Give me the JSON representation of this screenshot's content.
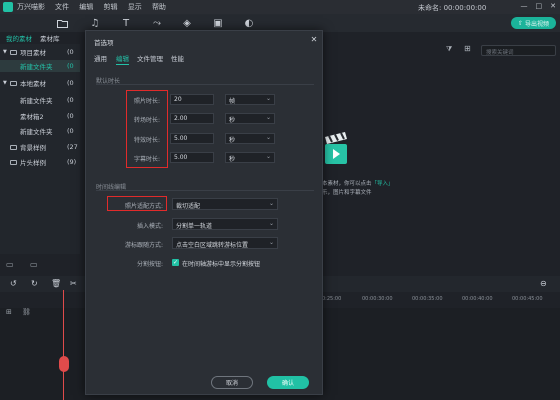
{
  "titlebar": {
    "app_name": "万兴喵影",
    "menu": [
      "文件",
      "编辑",
      "剪辑",
      "显示",
      "帮助"
    ],
    "project": "未命名: 00:00:00:00"
  },
  "toolbar": {
    "icons": [
      "folder-icon",
      "music-icon",
      "text-icon",
      "transition-icon",
      "effects-icon",
      "elements-icon",
      "split-screen-icon"
    ],
    "export_label": "导出视频"
  },
  "left_tabs": {
    "my_media": "我的素材",
    "library": "素材库"
  },
  "left_tree": [
    {
      "label": "项目素材",
      "count": "(0"
    },
    {
      "label": "新建文件夹",
      "count": "(0"
    },
    {
      "label": "本地素材",
      "count": "(0"
    },
    {
      "label": "新建文件夹",
      "count": "(0"
    },
    {
      "label": "素材箱2",
      "count": "(0"
    },
    {
      "label": "新建文件夹",
      "count": "(0"
    },
    {
      "label": "背景样例",
      "count": "(27"
    },
    {
      "label": "片头样例",
      "count": "(9)"
    }
  ],
  "media_panel": {
    "search_placeholder": "搜索关键词",
    "hint_line1_prefix": "本素材，你可以点击",
    "hint_highlight": "「导入」",
    "hint_line2": "乐，图片和字幕文件"
  },
  "timeline": {
    "ticks": [
      "0:25:00",
      "00:00:30:00",
      "00:00:35:00",
      "00:00:40:00",
      "00:00:45:00"
    ]
  },
  "dialog": {
    "title": "首选项",
    "tabs": [
      "通用",
      "编辑",
      "文件管理",
      "性能"
    ],
    "active_tab": "编辑",
    "section_default_duration": "默认时长",
    "fields": [
      {
        "label": "照片时长:",
        "value": "20",
        "unit": "帧"
      },
      {
        "label": "转场时长:",
        "value": "2.00",
        "unit": "秒"
      },
      {
        "label": "特效时长:",
        "value": "5.00",
        "unit": "秒"
      },
      {
        "label": "字幕时长:",
        "value": "5.00",
        "unit": "秒"
      }
    ],
    "section_timeline": "时间线编辑",
    "timeline_fields": [
      {
        "label": "照片适配方式:",
        "value": "裁切适配"
      },
      {
        "label": "插入模式:",
        "value": "分割单一轨道"
      },
      {
        "label": "游标跟随方式:",
        "value": "点击空白区域跳转游标位置"
      }
    ],
    "split_label": "分割按钮:",
    "split_check_label": "在时间轴游标中显示分割按钮",
    "cancel_label": "取消",
    "ok_label": "确认"
  },
  "colors": {
    "accent": "#21c1a5",
    "highlight_box": "#e12b2b"
  }
}
